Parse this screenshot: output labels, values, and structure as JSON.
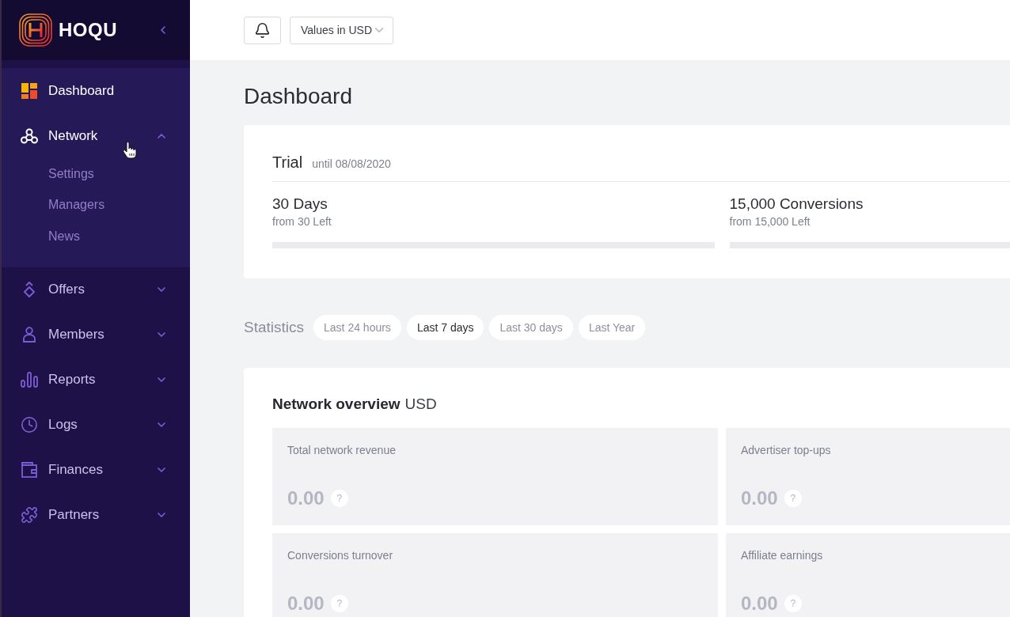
{
  "sidebar": {
    "logo": "HOQU",
    "items": [
      {
        "label": "Dashboard",
        "kind": "link",
        "selected": true
      },
      {
        "label": "Network",
        "kind": "group",
        "selected": false,
        "expanded": true,
        "children": [
          {
            "label": "Settings",
            "selected": false
          },
          {
            "label": "Managers",
            "selected": false
          },
          {
            "label": "News",
            "selected": false
          }
        ]
      },
      {
        "label": "Offers",
        "kind": "group",
        "selected": false,
        "expanded": false
      },
      {
        "label": "Members",
        "kind": "group",
        "selected": false,
        "expanded": false
      },
      {
        "label": "Reports",
        "kind": "group",
        "selected": false,
        "expanded": false
      },
      {
        "label": "Logs",
        "kind": "group",
        "selected": false,
        "expanded": false
      },
      {
        "label": "Finances",
        "kind": "group",
        "selected": false,
        "expanded": false
      },
      {
        "label": "Partners",
        "kind": "group",
        "selected": false,
        "expanded": false
      }
    ]
  },
  "top_bar": {
    "currency_select": {
      "value": "Values in USD"
    }
  },
  "page_title": "Dashboard",
  "trial": {
    "title": "Trial",
    "until": "until 08/08/2020",
    "stats": [
      {
        "value": "30 Days",
        "note": "from 30 Left"
      },
      {
        "value": "15,000 Conversions",
        "note": "from 15,000 Left"
      }
    ]
  },
  "statistics": {
    "label": "Statistics",
    "periods": [
      {
        "label": "Last 24 hours",
        "selected": false
      },
      {
        "label": "Last 7 days",
        "selected": true
      },
      {
        "label": "Last 30 days",
        "selected": false
      },
      {
        "label": "Last Year",
        "selected": false
      }
    ]
  },
  "overview": {
    "title": "Network overview",
    "currency": "USD",
    "tiles": [
      {
        "label": "Total network revenue",
        "value": "0.00",
        "help": "?"
      },
      {
        "label": "Advertiser top-ups",
        "value": "0.00",
        "help": "?"
      },
      {
        "label": "Conversions turnover",
        "value": "0.00",
        "help": "?"
      },
      {
        "label": "Affiliate earnings",
        "value": "0.00",
        "help": "?"
      }
    ]
  }
}
